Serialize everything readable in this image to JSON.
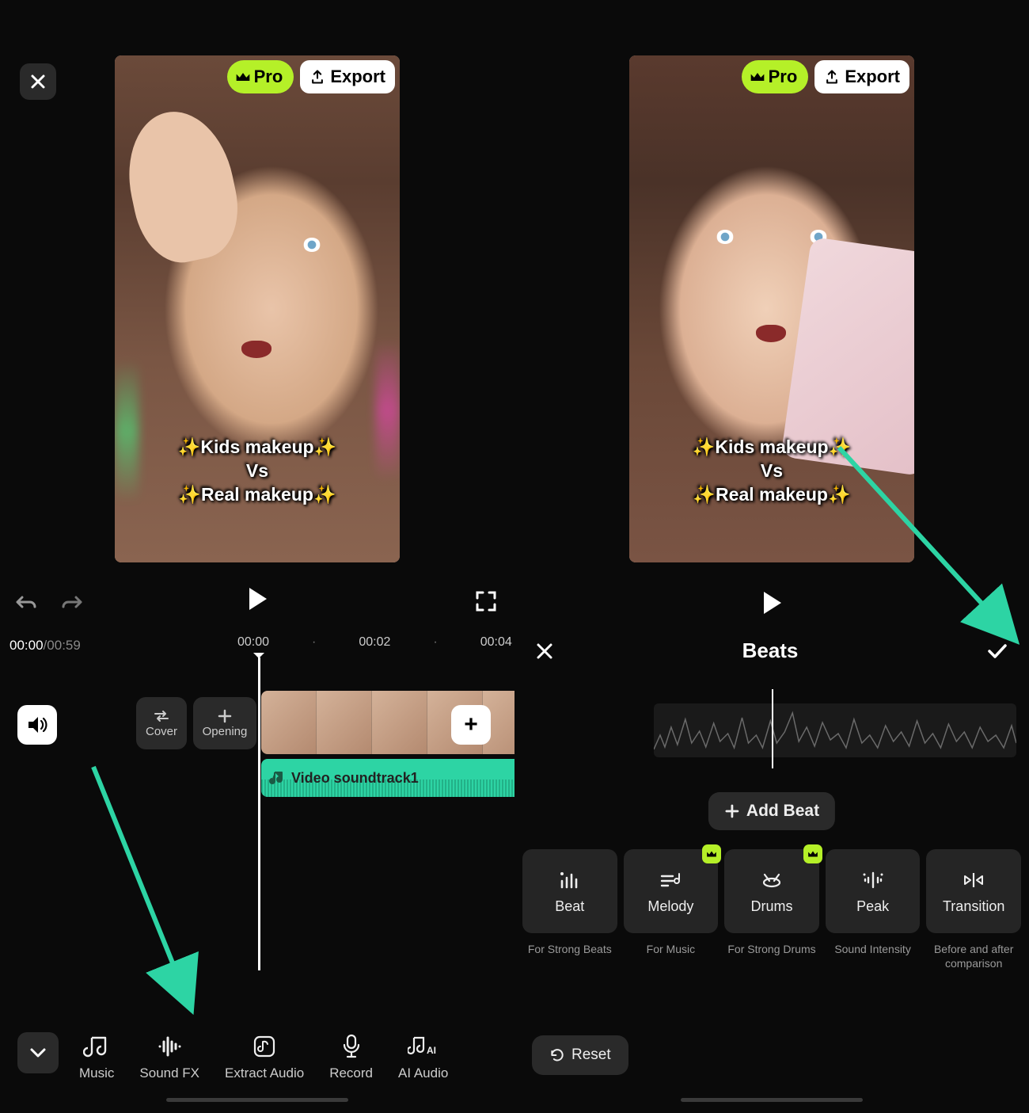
{
  "top": {
    "pro_label": "Pro",
    "export_label": "Export"
  },
  "preview": {
    "caption_line1": "✨Kids makeup✨",
    "caption_line2": "Vs",
    "caption_line3": "✨Real makeup✨"
  },
  "timeline": {
    "current": "00:00",
    "duration": "00:59",
    "ticks": [
      "00:00",
      "00:02",
      "00:04"
    ],
    "cover_label": "Cover",
    "opening_label": "Opening",
    "audio_label": "Video soundtrack1"
  },
  "tools": {
    "music": "Music",
    "soundfx": "Sound FX",
    "extract": "Extract Audio",
    "record": "Record",
    "ai_audio": "AI Audio"
  },
  "beats": {
    "title": "Beats",
    "add_label": "Add Beat",
    "tiles": [
      {
        "name": "Beat",
        "desc": "For Strong Beats",
        "premium": false
      },
      {
        "name": "Melody",
        "desc": "For Music",
        "premium": true
      },
      {
        "name": "Drums",
        "desc": "For Strong Drums",
        "premium": true
      },
      {
        "name": "Peak",
        "desc": "Sound Intensity",
        "premium": false
      },
      {
        "name": "Transition",
        "desc": "Before and after comparison",
        "premium": false
      }
    ],
    "reset_label": "Reset"
  }
}
